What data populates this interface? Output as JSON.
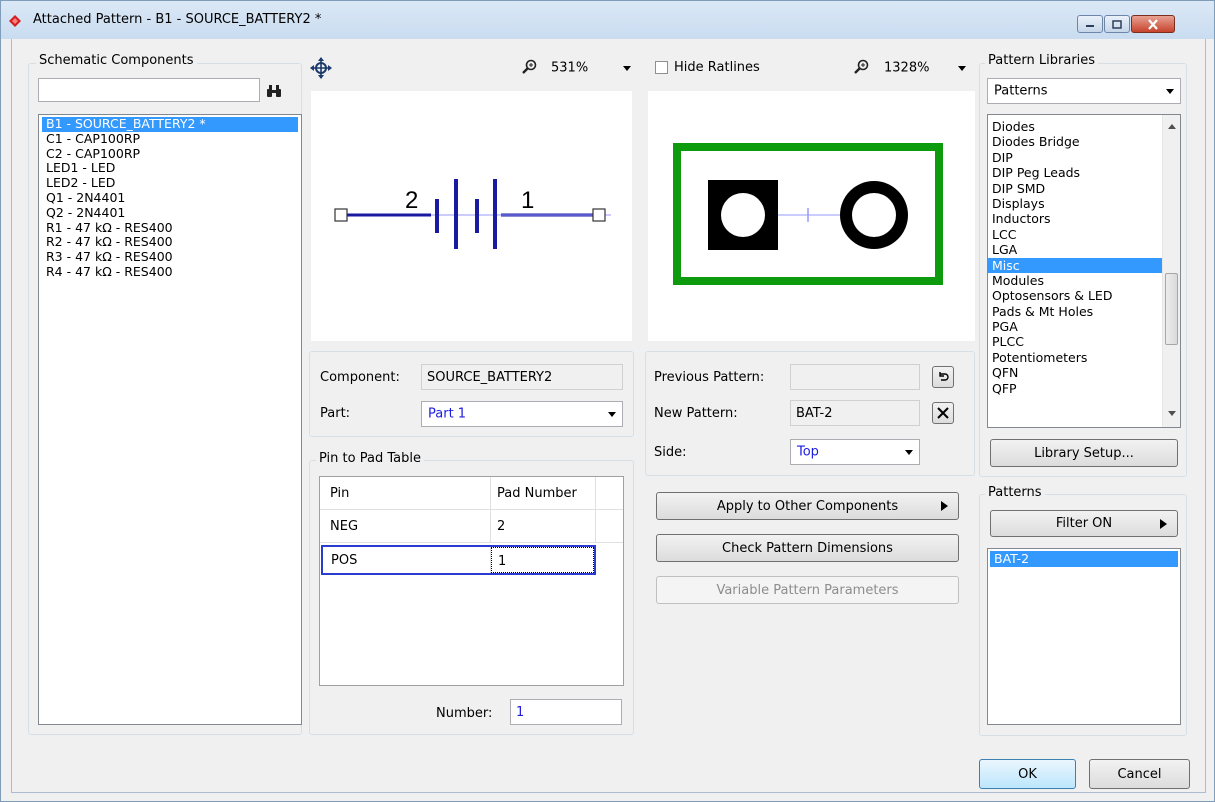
{
  "window": {
    "title": "Attached Pattern  -  B1 - SOURCE_BATTERY2 *"
  },
  "schematic": {
    "label": "Schematic Components",
    "search_value": "",
    "items": [
      "B1 - SOURCE_BATTERY2 *",
      "C1 - CAP100RP",
      "C2 - CAP100RP",
      "LED1 - LED",
      "LED2 - LED",
      "Q1 - 2N4401",
      "Q2 - 2N4401",
      "R1 - 47 kΩ - RES400",
      "R2 - 47 kΩ - RES400",
      "R3 - 47 kΩ - RES400",
      "R4 - 47 kΩ - RES400"
    ],
    "selected_index": 0
  },
  "preview": {
    "left_zoom": "531%",
    "hide_ratlines_label": "Hide Ratlines",
    "hide_ratlines_checked": false,
    "right_zoom": "1328%",
    "pin_left": "2",
    "pin_right": "1"
  },
  "component_info": {
    "component_label": "Component:",
    "component_value": "SOURCE_BATTERY2",
    "part_label": "Part:",
    "part_value": "Part 1"
  },
  "pin_table": {
    "label": "Pin to Pad Table",
    "headers": [
      "Pin",
      "Pad Number"
    ],
    "rows": [
      {
        "pin": "NEG",
        "pad": "2"
      },
      {
        "pin": "POS",
        "pad": "1"
      }
    ],
    "number_label": "Number:",
    "number_value": "1"
  },
  "pattern_info": {
    "previous_label": "Previous Pattern:",
    "previous_value": "",
    "new_label": "New Pattern:",
    "new_value": "BAT-2",
    "side_label": "Side:",
    "side_value": "Top"
  },
  "actions": {
    "apply_other": "Apply to Other Components",
    "check_dims": "Check Pattern Dimensions",
    "variable_params": "Variable Pattern Parameters"
  },
  "libraries": {
    "label": "Pattern Libraries",
    "combo_value": "Patterns",
    "items": [
      "Diodes",
      "Diodes Bridge",
      "DIP",
      "DIP Peg Leads",
      "DIP SMD",
      "Displays",
      "Inductors",
      "LCC",
      "LGA",
      "Misc",
      "Modules",
      "Optosensors & LED",
      "Pads & Mt Holes",
      "PGA",
      "PLCC",
      "Potentiometers",
      "QFN",
      "QFP"
    ],
    "selected_index": 9,
    "setup_button": "Library Setup..."
  },
  "patterns": {
    "label": "Patterns",
    "filter_button": "Filter ON",
    "items": [
      "BAT-2"
    ],
    "selected_index": 0
  },
  "footer": {
    "ok": "OK",
    "cancel": "Cancel"
  },
  "colors": {
    "selection": "#3399ff",
    "pcb_outline": "#0d9b0d",
    "schematic_wire": "#1a1aa0",
    "ratline": "#9999ff"
  }
}
